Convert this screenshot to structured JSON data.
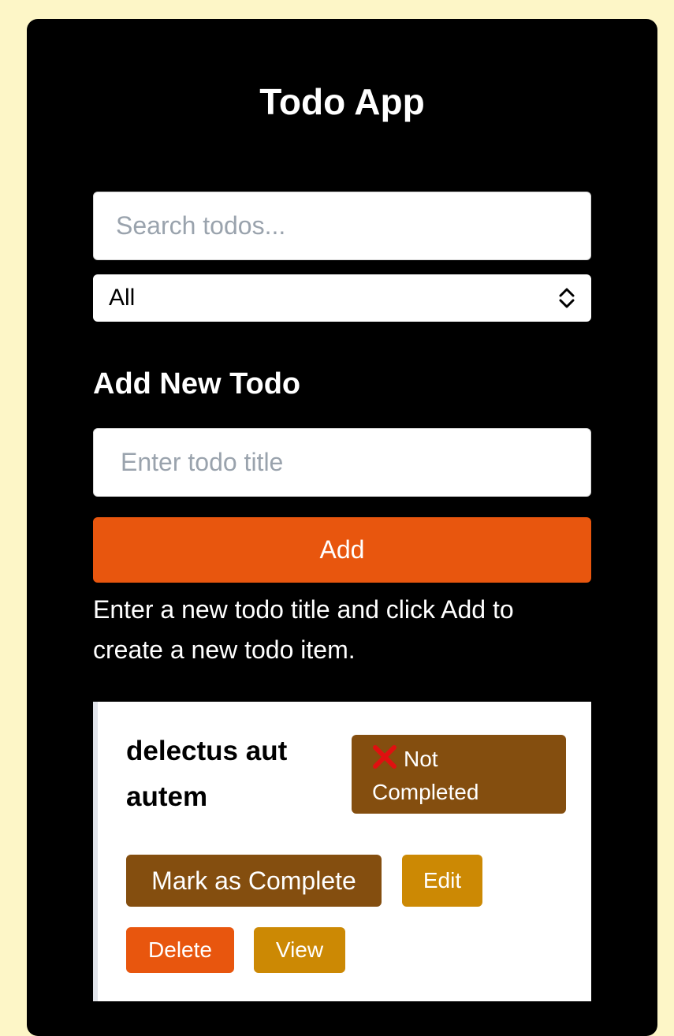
{
  "app": {
    "title": "Todo App"
  },
  "search": {
    "placeholder": "Search todos...",
    "value": ""
  },
  "filter": {
    "selected": "All",
    "icon": "chevron-updown-icon"
  },
  "add_section": {
    "title": "Add New Todo",
    "input_placeholder": "Enter todo title",
    "input_value": "",
    "button_label": "Add",
    "hint": "Enter a new todo title and click Add to create a new todo item."
  },
  "todos": [
    {
      "title": "delectus aut autem",
      "status_icon": "x-icon",
      "status_label": "Not Completed",
      "actions": {
        "complete_label": "Mark as Complete",
        "edit_label": "Edit",
        "delete_label": "Delete",
        "view_label": "View"
      }
    }
  ],
  "colors": {
    "page_bg": "#fdf6c7",
    "app_bg": "#000000",
    "accent_orange": "#e8560e",
    "brown": "#844e0f",
    "gold": "#cc8904",
    "status_x": "#e01010"
  }
}
